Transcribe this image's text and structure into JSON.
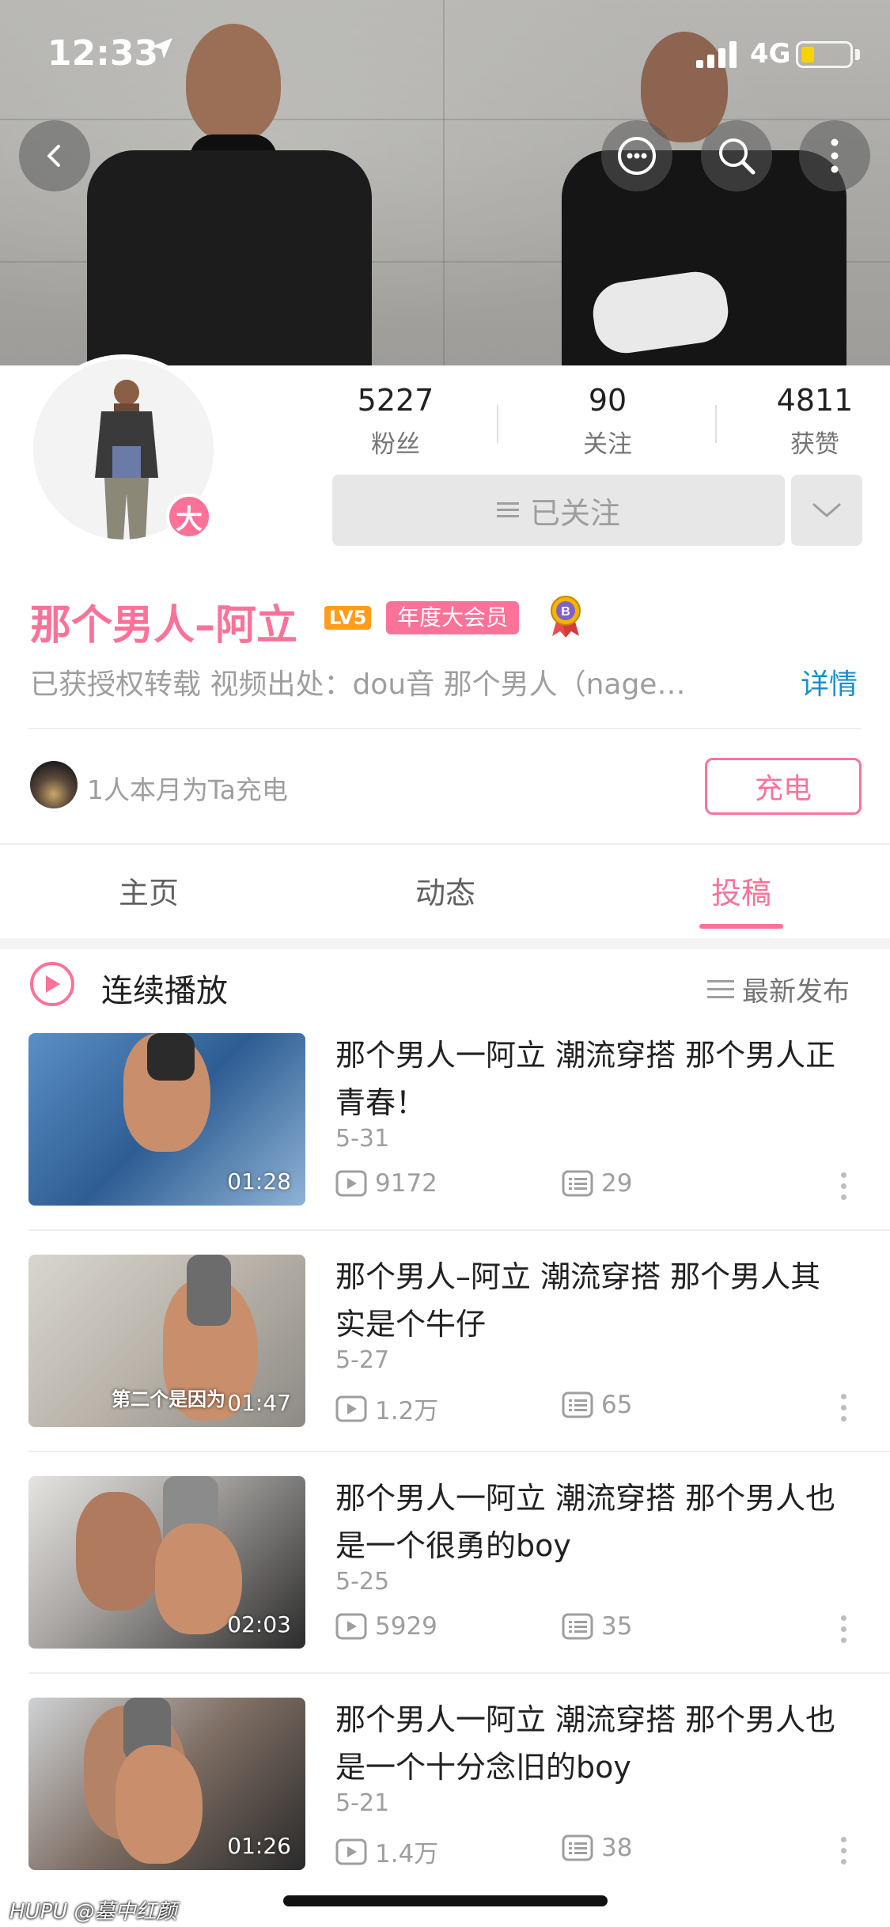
{
  "status_bar": {
    "time": "12:33",
    "network": "4G"
  },
  "stats": [
    {
      "value": "5227",
      "label": "粉丝"
    },
    {
      "value": "90",
      "label": "关注"
    },
    {
      "value": "4811",
      "label": "获赞"
    }
  ],
  "follow_button": {
    "label": "已关注",
    "icon": "menu-icon"
  },
  "profile": {
    "avatar_badge": "大",
    "username": "那个男人–阿立",
    "level": "LV5",
    "vip": "年度大会员",
    "bio": "已获授权转载  视频出处：dou音    那个男人（nage…",
    "detail_link": "详情"
  },
  "charge": {
    "text": "1人本月为Ta充电",
    "button": "充电"
  },
  "tabs": [
    {
      "label": "主页",
      "active": false
    },
    {
      "label": "动态",
      "active": false
    },
    {
      "label": "投稿",
      "active": true
    }
  ],
  "playlist": {
    "play_label": "连续播放",
    "sort_label": "最新发布"
  },
  "videos": [
    {
      "title": "那个男人一阿立  潮流穿搭  那个男人正青春！",
      "date": "5-31",
      "views": "9172",
      "comments": "29",
      "duration": "01:28",
      "caption": ""
    },
    {
      "title": "那个男人–阿立    潮流穿搭  那个男人其实是个牛仔",
      "date": "5-27",
      "views": "1.2万",
      "comments": "65",
      "duration": "01:47",
      "caption": "第二个是因为"
    },
    {
      "title": "那个男人一阿立  潮流穿搭  那个男人也是一个很勇的boy",
      "date": "5-25",
      "views": "5929",
      "comments": "35",
      "duration": "02:03",
      "caption": ""
    },
    {
      "title": "那个男人一阿立  潮流穿搭  那个男人也是一个十分念旧的boy",
      "date": "5-21",
      "views": "1.4万",
      "comments": "38",
      "duration": "01:26",
      "caption": ""
    }
  ],
  "watermark": "HUPU @墓中红颜",
  "colors": {
    "accent": "#fb7299",
    "link": "#1a8fd0"
  }
}
